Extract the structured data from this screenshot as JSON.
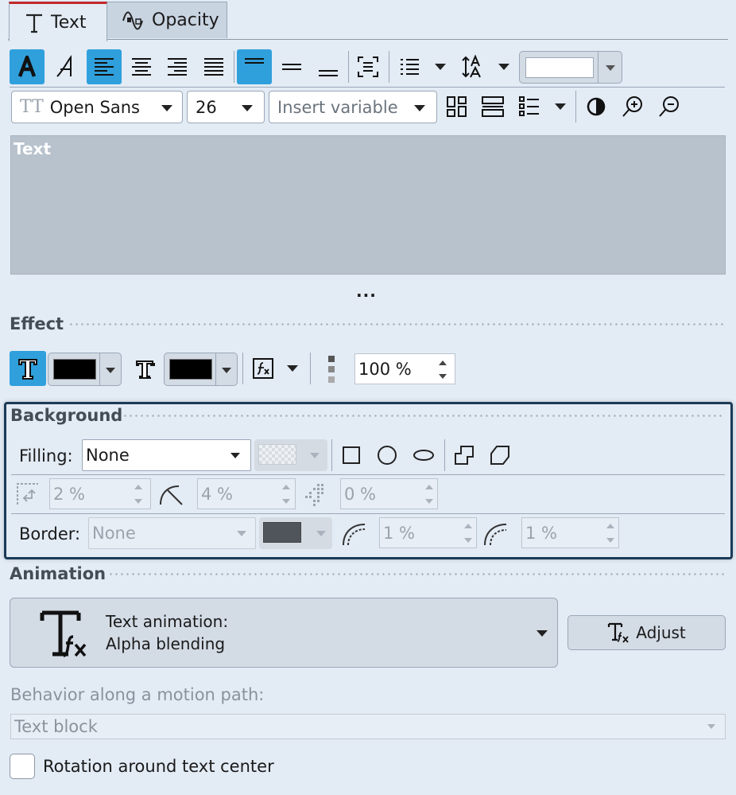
{
  "tabs": [
    {
      "label": "Text",
      "icon": "text-T-icon",
      "active": true
    },
    {
      "label": "Opacity",
      "icon": "opacity-wave-icon",
      "active": false
    }
  ],
  "toolbar2": {
    "font": "Open Sans",
    "size": "26",
    "variable_placeholder": "Insert variable"
  },
  "text_area": {
    "value": "Text",
    "background": "#b8c2cd"
  },
  "more": "...",
  "effect": {
    "title": "Effect",
    "outline_color": "#000000",
    "shadow_color": "#000000",
    "opacity": "100 %"
  },
  "background": {
    "title": "Background",
    "filling_label": "Filling:",
    "filling_value": "None",
    "margin_value": "2 %",
    "corner_value": "4 %",
    "shadow_value": "0 %",
    "border_label": "Border:",
    "border_value": "None",
    "border_color": "#50555c",
    "border_width_value": "1 %",
    "border_radius_value": "1 %",
    "frame_color": "#1b3a57"
  },
  "animation": {
    "title": "Animation",
    "line1": "Text animation:",
    "line2": "Alpha blending",
    "adjust_label": "Adjust"
  },
  "motion": {
    "label": "Behavior along a motion path:",
    "value": "Text block"
  },
  "rotation": {
    "label": "Rotation around text center",
    "checked": false
  },
  "colors": {
    "accent": "#2fa0dc",
    "tab_accent": "#c0282a"
  }
}
